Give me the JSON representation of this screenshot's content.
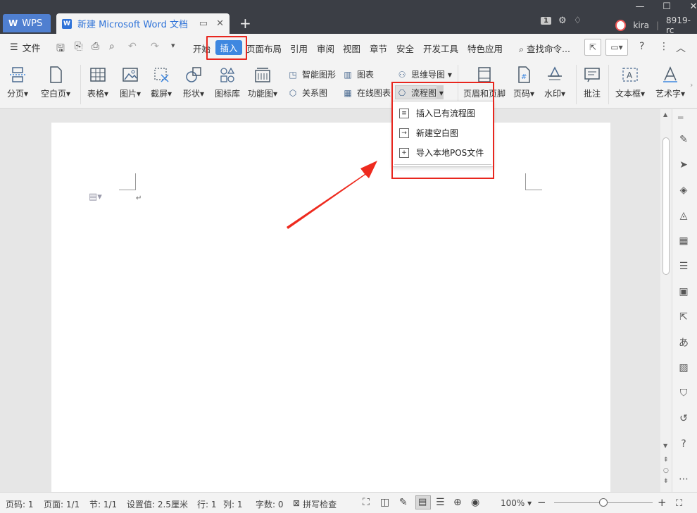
{
  "titlebar": {
    "wps_tab": "WPS",
    "doc_tab": "新建 Microsoft Word 文档",
    "badge": "1",
    "user": "kira",
    "account": "8919-rc"
  },
  "menu": {
    "file": "文件",
    "items": [
      "开始",
      "插入",
      "页面布局",
      "引用",
      "审阅",
      "视图",
      "章节",
      "安全",
      "开发工具",
      "特色应用"
    ],
    "search": "查找命令..."
  },
  "ribbon": {
    "page_break": "分页",
    "blank_page": "空白页",
    "table": "表格",
    "picture": "图片",
    "screenshot": "截屏",
    "shape": "形状",
    "icon_library": "图标库",
    "function_chart": "功能图",
    "smart_art": "智能图形",
    "chart": "图表",
    "mind_map": "思维导图",
    "relation_chart": "关系图",
    "online_chart": "在线图表",
    "flowchart": "流程图",
    "header_footer": "页眉和页脚",
    "page_number": "页码",
    "watermark": "水印",
    "comment": "批注",
    "textbox": "文本框",
    "wordart": "艺术字"
  },
  "dropdown": {
    "items": [
      "插入已有流程图",
      "新建空白图",
      "导入本地POS文件"
    ]
  },
  "status": {
    "page_no": "页码: 1",
    "pages": "页面: 1/1",
    "section": "节: 1/1",
    "setting": "设置值: 2.5厘米",
    "row": "行: 1",
    "col": "列: 1",
    "words": "字数: 0",
    "spell": "拼写检查",
    "zoom": "100%",
    "zoom_level": 0.5
  },
  "colors": {
    "accent": "#3e87e0",
    "highlight": "#e8261e",
    "titlebar": "#3b3e45"
  }
}
